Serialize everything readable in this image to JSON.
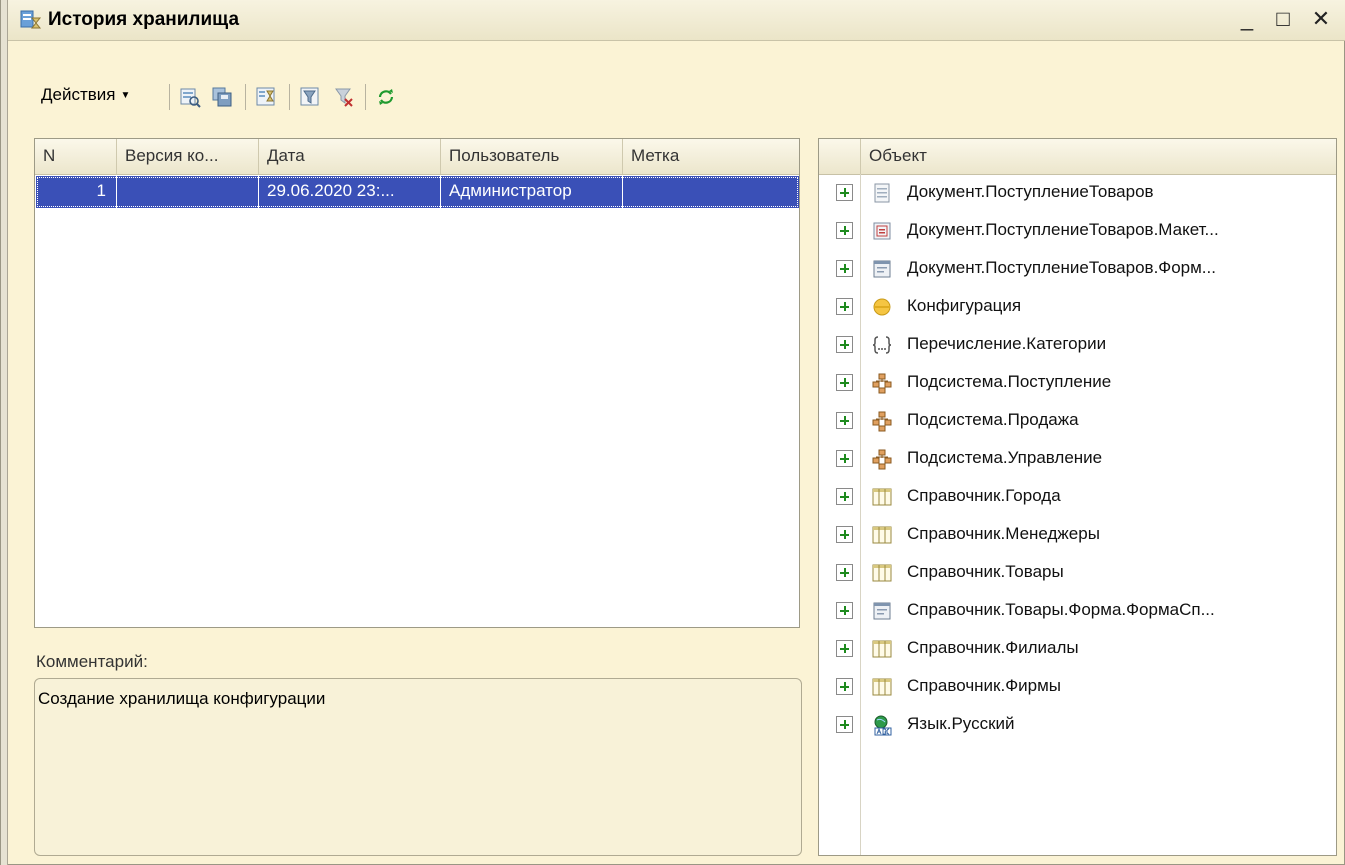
{
  "window": {
    "title": "История хранилища",
    "minimize": "_",
    "maximize": "□",
    "close": "✕"
  },
  "toolbar": {
    "actions_label": "Действия",
    "actions_arrow": "▼"
  },
  "history": {
    "columns": [
      "N",
      "Версия ко...",
      "Дата",
      "Пользователь",
      "Метка"
    ],
    "rows": [
      {
        "n": "1",
        "version": "",
        "date": "29.06.2020 23:...",
        "user": "Администратор",
        "label": ""
      }
    ]
  },
  "comment": {
    "label": "Комментарий:",
    "text": "Создание хранилища конфигурации"
  },
  "objects": {
    "header": "Объект",
    "items": [
      {
        "label": "Документ.ПоступлениеТоваров",
        "icon": "document-icon"
      },
      {
        "label": "Документ.ПоступлениеТоваров.Макет...",
        "icon": "template-icon"
      },
      {
        "label": "Документ.ПоступлениеТоваров.Форм...",
        "icon": "form-icon"
      },
      {
        "label": "Конфигурация",
        "icon": "configuration-icon"
      },
      {
        "label": "Перечисление.Категории",
        "icon": "enum-icon"
      },
      {
        "label": "Подсистема.Поступление",
        "icon": "subsystem-icon"
      },
      {
        "label": "Подсистема.Продажа",
        "icon": "subsystem-icon"
      },
      {
        "label": "Подсистема.Управление",
        "icon": "subsystem-icon"
      },
      {
        "label": "Справочник.Города",
        "icon": "catalog-icon"
      },
      {
        "label": "Справочник.Менеджеры",
        "icon": "catalog-icon"
      },
      {
        "label": "Справочник.Товары",
        "icon": "catalog-icon"
      },
      {
        "label": "Справочник.Товары.Форма.ФормаСп...",
        "icon": "form-icon"
      },
      {
        "label": "Справочник.Филиалы",
        "icon": "catalog-icon"
      },
      {
        "label": "Справочник.Фирмы",
        "icon": "catalog-icon"
      },
      {
        "label": "Язык.Русский",
        "icon": "language-icon"
      }
    ]
  }
}
